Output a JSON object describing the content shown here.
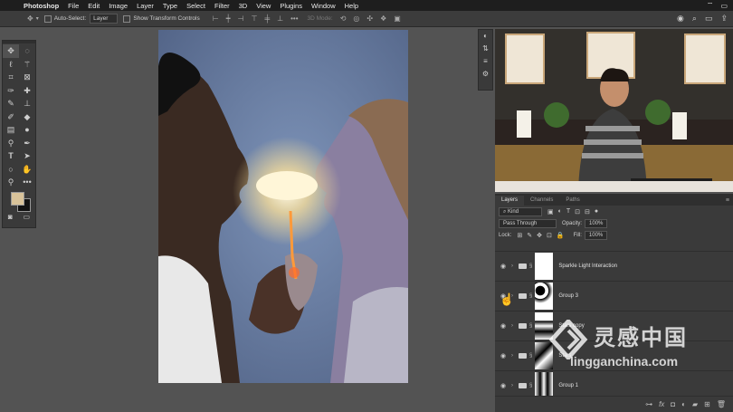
{
  "menubar": {
    "app": "Photoshop",
    "items": [
      "File",
      "Edit",
      "Image",
      "Layer",
      "Type",
      "Select",
      "Filter",
      "3D",
      "View",
      "Plugins",
      "Window",
      "Help"
    ]
  },
  "options_bar": {
    "auto_select_label": "Auto-Select:",
    "auto_select_value": "Layer",
    "transform_label": "Show Transform Controls",
    "mode_3d": "3D Mode:"
  },
  "tools": [
    "move-tool",
    "marquee-tool",
    "lasso-tool",
    "magic-wand-tool",
    "crop-tool",
    "frame-tool",
    "eyedropper-tool",
    "healing-tool",
    "brush-tool",
    "stamp-tool",
    "history-brush-tool",
    "eraser-tool",
    "gradient-tool",
    "blur-tool",
    "dodge-tool",
    "pen-tool",
    "type-tool",
    "path-select-tool",
    "shape-tool",
    "hand-tool",
    "zoom-tool",
    "more-tools"
  ],
  "colors": {
    "foreground": "#d9c39a",
    "background": "#111111",
    "accent": "#3a3a3a"
  },
  "layers_panel": {
    "tabs": [
      "Layers",
      "Channels",
      "Paths"
    ],
    "filter": "Kind",
    "blend_mode": "Pass Through",
    "opacity_label": "Opacity:",
    "opacity_value": "100%",
    "lock_label": "Lock:",
    "fill_label": "Fill:",
    "fill_value": "100%",
    "layers": [
      {
        "name": "Sparkle Light Interaction"
      },
      {
        "name": "Group 3"
      },
      {
        "name": "Stars copy"
      },
      {
        "name": "Stars"
      },
      {
        "name": "Group 1"
      }
    ]
  },
  "watermark": {
    "cn": "灵感中国",
    "url": "lingganchina.com"
  }
}
